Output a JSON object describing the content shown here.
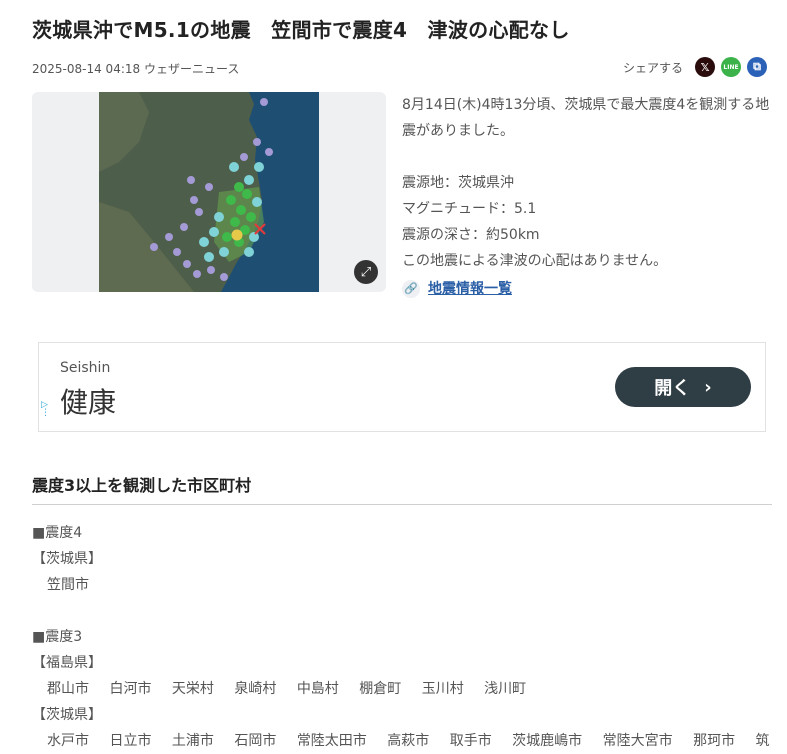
{
  "article": {
    "title": "茨城県沖でM5.1の地震　笠間市で震度4　津波の心配なし",
    "date": "2025-08-14 04:18",
    "source": "ウェザーニュース"
  },
  "share": {
    "label": "シェアする",
    "x_glyph": "𝕏",
    "line_glyph": "LINE",
    "copy_glyph": "⧉"
  },
  "summary": {
    "lead": "8月14日(木)4時13分頃、茨城県で最大震度4を観測する地震がありました。",
    "epicenter": "震源地：茨城県沖",
    "magnitude": "マグニチュード：5.1",
    "depth": "震源の深さ：約50km",
    "tsunami": "この地震による津波の心配はありません。",
    "link_label": "地震情報一覧"
  },
  "ad": {
    "brand": "Seishin",
    "headline": "健康",
    "button_label": "開く",
    "button_arrow": "›"
  },
  "section": {
    "heading": "震度3以上を観測した市区町村"
  },
  "intensity": {
    "level4": {
      "label": "■震度4",
      "prefectures": [
        {
          "name": "【茨城県】",
          "towns": [
            "笠間市"
          ]
        }
      ]
    },
    "level3": {
      "label": "■震度3",
      "prefectures": [
        {
          "name": "【福島県】",
          "towns": [
            "郡山市",
            "白河市",
            "天栄村",
            "泉崎村",
            "中島村",
            "棚倉町",
            "玉川村",
            "浅川町"
          ]
        },
        {
          "name": "【茨城県】",
          "towns": [
            "水戸市",
            "日立市",
            "土浦市",
            "石岡市",
            "常陸太田市",
            "高萩市",
            "取手市",
            "茨城鹿嶋市",
            "常陸大宮市",
            "那珂市",
            "筑"
          ]
        }
      ]
    }
  },
  "colors": {
    "link": "#2b5fa6",
    "ad_button": "#2f3d44",
    "sea": "#1f4e73"
  }
}
